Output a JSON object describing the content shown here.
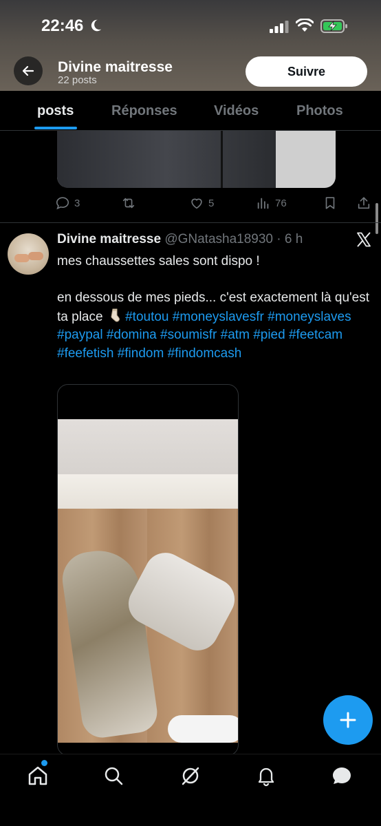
{
  "status_bar": {
    "time": "22:46"
  },
  "header": {
    "title": "Divine maitresse",
    "subtitle": "22 posts",
    "follow_label": "Suivre"
  },
  "tabs": [
    {
      "label": "posts",
      "active": true
    },
    {
      "label": "Réponses",
      "active": false
    },
    {
      "label": "Vidéos",
      "active": false
    },
    {
      "label": "Photos",
      "active": false
    }
  ],
  "previous_post": {
    "actions": {
      "replies": "3",
      "likes": "5",
      "views": "76"
    }
  },
  "post": {
    "author": "Divine maitresse",
    "handle": "@GNatasha18930",
    "time": " · 6 h",
    "line1": "mes chaussettes sales sont dispo !",
    "line2": "en dessous de mes pieds... c'est exactement là qu'est ta place",
    "hashtags": [
      "#toutou",
      "#moneyslavesfr",
      "#moneyslaves",
      "#paypal",
      "#domina",
      "#soumisfr",
      "#atm",
      "#pied",
      "#feetcam",
      "#feefetish",
      "#findom",
      "#findomcash"
    ]
  },
  "icons": {
    "moon": "moon-icon",
    "signal": "signal-icon",
    "wifi": "wifi-icon",
    "battery": "battery-charging-icon",
    "back": "back-arrow-icon",
    "x": "x-logo-icon",
    "reply": "reply-icon",
    "repost": "repost-icon",
    "like": "heart-icon",
    "views": "views-icon",
    "bookmark": "bookmark-icon",
    "share": "share-icon",
    "compose": "plus-icon",
    "home": "home-icon",
    "search": "search-icon",
    "grok": "grok-icon",
    "notifications": "bell-icon",
    "messages": "chat-icon"
  },
  "colors": {
    "accent": "#1d9bf0",
    "background": "#000000",
    "muted": "#71767b",
    "text": "#e7e9ea"
  }
}
